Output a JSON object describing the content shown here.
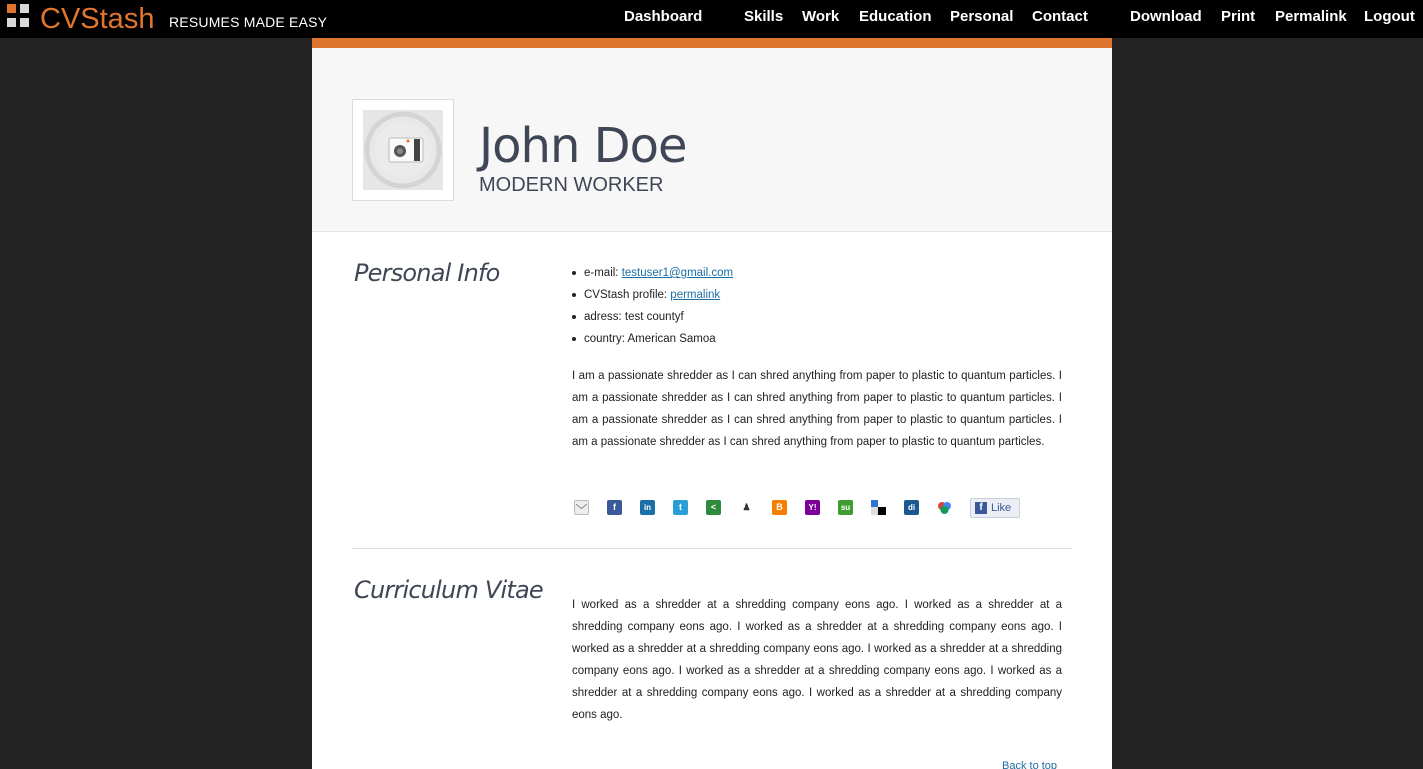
{
  "brand": {
    "name": "CVStash",
    "tagline": "RESUMES MADE EASY"
  },
  "nav": {
    "dashboard": "Dashboard",
    "skills": "Skills",
    "work": "Work",
    "education": "Education",
    "personal": "Personal",
    "contact": "Contact",
    "download": "Download",
    "print": "Print",
    "permalink": "Permalink",
    "logout": "Logout"
  },
  "profile": {
    "name": "John Doe",
    "title": "MODERN WORKER"
  },
  "personal_info": {
    "heading": "Personal Info",
    "items": [
      {
        "label": "e-mail: ",
        "link": "testuser1@gmail.com"
      },
      {
        "label": "CVStash profile: ",
        "link": "permalink"
      },
      {
        "label": "adress: test countyf"
      },
      {
        "label": "country: American Samoa"
      }
    ],
    "bio": "I am a passionate shredder as I can shred anything from paper to plastic to quantum particles. I am a passionate shredder as I can shred anything from paper to plastic to quantum particles. I am a passionate shredder as I can shred anything from paper to plastic to quantum particles. I am a passionate shredder as I can shred anything from paper to plastic to quantum particles."
  },
  "share": {
    "icons": [
      "email-icon",
      "facebook-icon",
      "linkedin-icon",
      "twitter-icon",
      "share-icon",
      "myspace-icon",
      "blogger-icon",
      "yahoo-icon",
      "stumbleupon-icon",
      "delicious-icon",
      "digg-icon",
      "google-icon"
    ],
    "like_label": "Like"
  },
  "cv": {
    "heading": "Curriculum Vitae",
    "text": "I worked as a shredder at a shredding company eons ago. I worked as a shredder at a shredding company eons ago. I worked as a shredder at a shredding company eons ago. I worked as a shredder at a shredding company eons ago. I worked as a shredder at a shredding company eons ago. I worked as a shredder at a shredding company eons ago. I worked as a shredder at a shredding company eons ago. I worked as a shredder at a shredding company eons ago."
  },
  "footer": {
    "back_to_top": "Back to top"
  },
  "colors": {
    "accent": "#e0762e",
    "topbar": "#000000",
    "background": "#242424",
    "heading": "#3f4756",
    "link": "#1d6fa5"
  }
}
